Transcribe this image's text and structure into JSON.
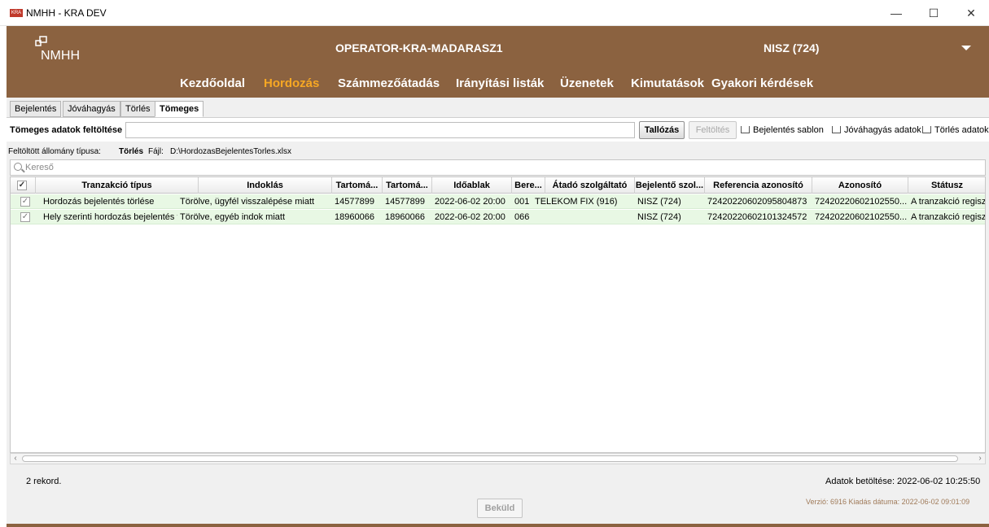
{
  "window": {
    "app_icon_text": "KRA",
    "title": "NMHH - KRA DEV",
    "minimize": "—",
    "maximize": "☐",
    "close": "✕"
  },
  "header": {
    "logo_text": "NMHH",
    "operator": "OPERATOR-KRA-MADARASZ1",
    "organization": "NISZ (724)",
    "brand_color": "#8b6240",
    "active_color": "#f7a823"
  },
  "nav": {
    "items": [
      {
        "label": "Kezdőoldal"
      },
      {
        "label": "Hordozás",
        "active": true
      },
      {
        "label": "Számmezőátadás"
      },
      {
        "label": "Irányítási listák"
      },
      {
        "label": "Üzenetek"
      },
      {
        "label": "Kimutatások"
      },
      {
        "label": "Gyakori kérdések"
      }
    ]
  },
  "tabs": [
    {
      "label": "Bejelentés"
    },
    {
      "label": "Jóváhagyás"
    },
    {
      "label": "Törlés"
    },
    {
      "label": "Tömeges",
      "active": true
    }
  ],
  "upload": {
    "label": "Tömeges adatok feltöltése",
    "value": "",
    "browse_label": "Tallózás",
    "upload_label": "Feltöltés",
    "links": [
      "Bejelentés sablon",
      "Jóváhagyás adatok",
      "Törlés adatok"
    ]
  },
  "file_info": {
    "type_label": "Feltöltött állomány típusa:",
    "type_value": "Törlés",
    "file_label": "Fájl:",
    "file_value": "D:\\HordozasBejelentesTorles.xlsx"
  },
  "search": {
    "placeholder": "Kereső"
  },
  "table": {
    "header_check": "✓",
    "columns": [
      "Tranzakció típus",
      "Indoklás",
      "Tartomá...",
      "Tartomá...",
      "Időablak",
      "Bere...",
      "Átadó szolgáltató",
      "Bejelentő szol...",
      "Referencia azonosító",
      "Azonosító",
      "Státusz"
    ],
    "rows": [
      {
        "check": "✓",
        "cells": [
          "Hordozás bejelentés törlése",
          "Törölve, ügyfél visszalépése miatt",
          "14577899",
          "14577899",
          "2022-06-02 20:00",
          "001",
          "TELEKOM FIX (916)",
          "NISZ (724)",
          "72420220602095804873",
          "72420220602102550...",
          "A tranzakció regisztrá"
        ]
      },
      {
        "check": "✓",
        "cells": [
          "Hely szerinti hordozás bejelentés törlé...",
          "Törölve, egyéb indok miatt",
          "18960066",
          "18960066",
          "2022-06-02 20:00",
          "066",
          "",
          "NISZ (724)",
          "72420220602101324572",
          "72420220602102550...",
          "A tranzakció regisztrá"
        ]
      }
    ],
    "row_color": "#e8f8e4"
  },
  "scroll": {
    "left": "‹",
    "right": "›"
  },
  "footer": {
    "records": "2 rekord.",
    "loaded": "Adatok betöltése: 2022-06-02 10:25:50",
    "send_label": "Beküld",
    "version": "Verzió: 6916 Kiadás dátuma: 2022-06-02 09:01:09"
  }
}
